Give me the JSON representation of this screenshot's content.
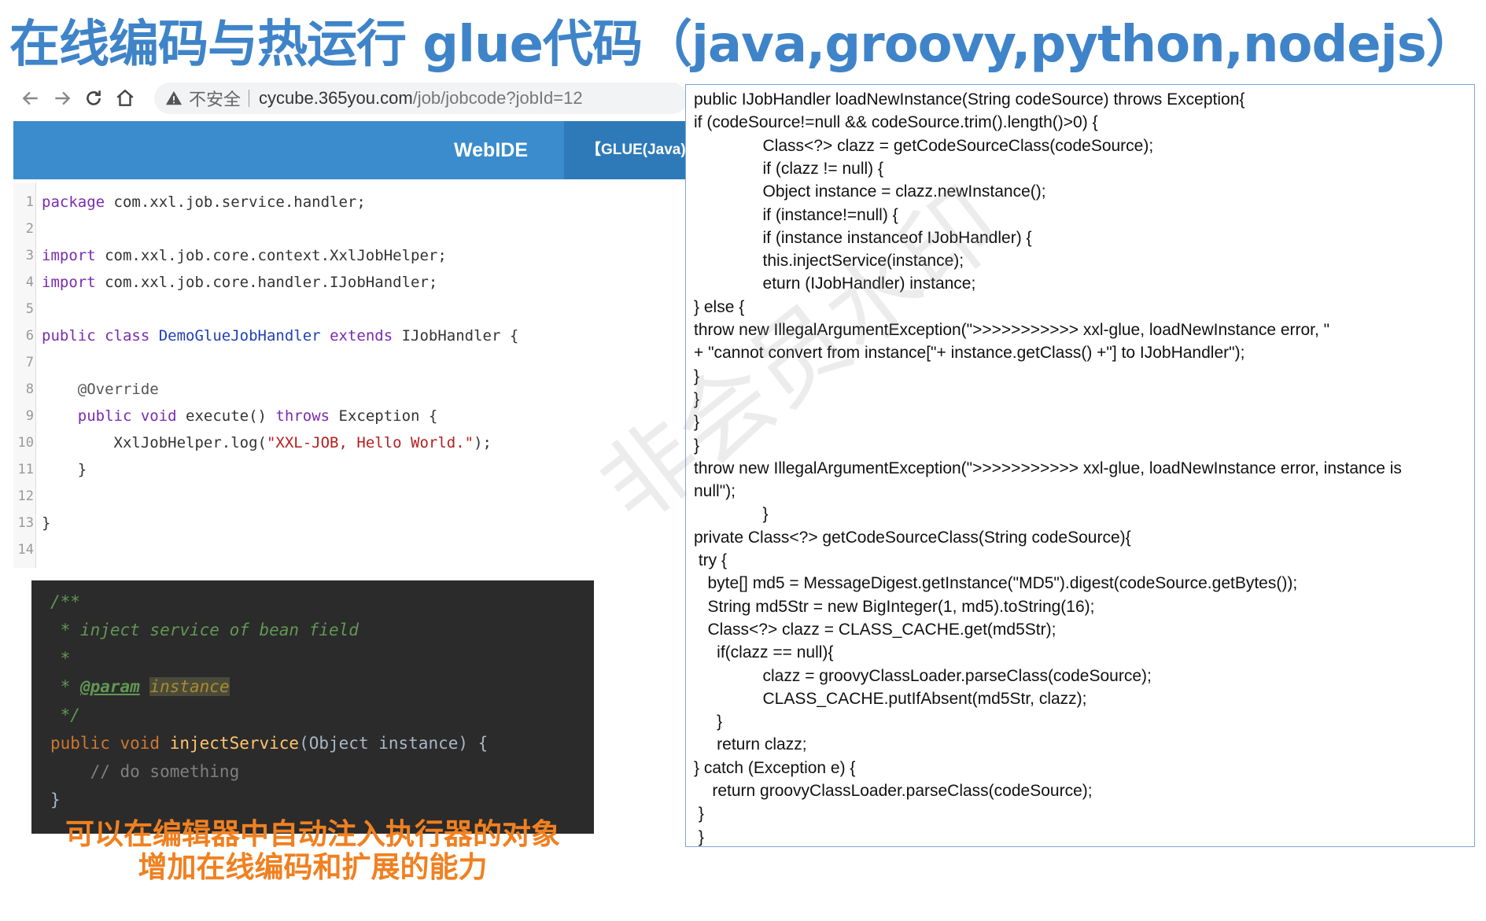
{
  "title": "在线编码与热运行 glue代码（java,groovy,python,nodejs）",
  "browser": {
    "insecure_label": "不安全",
    "url_host": "cycube.365you.com",
    "url_path": "/job/jobcode?jobId=12",
    "icons": [
      "back-icon",
      "forward-icon",
      "reload-icon",
      "home-icon",
      "warning-icon"
    ]
  },
  "ide": {
    "brand": "WebIDE",
    "tab": "【GLUE(Java)】"
  },
  "editor_lines": [
    {
      "n": "1",
      "parts": [
        [
          "kw",
          "package"
        ],
        [
          "t",
          " com.xxl.job.service.handler;"
        ]
      ]
    },
    {
      "n": "2",
      "parts": []
    },
    {
      "n": "3",
      "parts": [
        [
          "kw",
          "import"
        ],
        [
          "t",
          " com.xxl.job.core.context.XxlJobHelper;"
        ]
      ]
    },
    {
      "n": "4",
      "parts": [
        [
          "kw",
          "import"
        ],
        [
          "t",
          " com.xxl.job.core.handler.IJobHandler;"
        ]
      ]
    },
    {
      "n": "5",
      "parts": []
    },
    {
      "n": "6",
      "parts": [
        [
          "kw",
          "public class "
        ],
        [
          "cls",
          "DemoGlueJobHandler"
        ],
        [
          "kw",
          " extends"
        ],
        [
          "t",
          " IJobHandler {"
        ]
      ]
    },
    {
      "n": "7",
      "parts": []
    },
    {
      "n": "8",
      "parts": [
        [
          "ann",
          "    @Override"
        ]
      ]
    },
    {
      "n": "9",
      "parts": [
        [
          "kw",
          "    public void"
        ],
        [
          "t",
          " execute() "
        ],
        [
          "kw",
          "throws"
        ],
        [
          "t",
          " Exception {"
        ]
      ]
    },
    {
      "n": "10",
      "parts": [
        [
          "t",
          "        XxlJobHelper.log("
        ],
        [
          "str",
          "\"XXL-JOB, Hello World.\""
        ],
        [
          "t",
          ");"
        ]
      ]
    },
    {
      "n": "11",
      "parts": [
        [
          "t",
          "    }"
        ]
      ]
    },
    {
      "n": "12",
      "parts": []
    },
    {
      "n": "13",
      "parts": [
        [
          "t",
          "}"
        ]
      ]
    },
    {
      "n": "14",
      "parts": []
    }
  ],
  "dark_lines": [
    [
      [
        "doc",
        "/**"
      ]
    ],
    [
      [
        "doc",
        " * inject service of bean field"
      ]
    ],
    [
      [
        "doc",
        " *"
      ]
    ],
    [
      [
        "doc",
        " * "
      ],
      [
        "dparam",
        "@param"
      ],
      [
        "doc",
        " "
      ],
      [
        "dinst",
        "instance"
      ]
    ],
    [
      [
        "doc",
        " */"
      ]
    ],
    [
      [
        "dkw",
        "public void "
      ],
      [
        "dfn",
        "injectService"
      ],
      [
        "dtx",
        "(Object instance) {"
      ]
    ],
    [
      [
        "dcm",
        "    // do something"
      ]
    ],
    [
      [
        "dtx",
        "}"
      ]
    ]
  ],
  "caption_line1": "可以在编辑器中自动注入执行器的对象",
  "caption_line2": "增加在线编码和扩展的能力",
  "right_code": [
    "public IJobHandler loadNewInstance(String codeSource) throws Exception{",
    "if (codeSource!=null && codeSource.trim().length()>0) {",
    "               Class<?> clazz = getCodeSourceClass(codeSource);",
    "               if (clazz != null) {",
    "               Object instance = clazz.newInstance();",
    "               if (instance!=null) {",
    "               if (instance instanceof IJobHandler) {",
    "               this.injectService(instance);",
    "               eturn (IJobHandler) instance;",
    "} else {",
    "throw new IllegalArgumentException(\">>>>>>>>>>> xxl-glue, loadNewInstance error, \"",
    "+ \"cannot convert from instance[\"+ instance.getClass() +\"] to IJobHandler\");",
    "}",
    "}",
    "}",
    "}",
    "throw new IllegalArgumentException(\">>>>>>>>>>> xxl-glue, loadNewInstance error, instance is",
    "null\");",
    "               }",
    "private Class<?> getCodeSourceClass(String codeSource){",
    " try {",
    "   byte[] md5 = MessageDigest.getInstance(\"MD5\").digest(codeSource.getBytes());",
    "   String md5Str = new BigInteger(1, md5).toString(16);",
    "   Class<?> clazz = CLASS_CACHE.get(md5Str);",
    "     if(clazz == null){",
    "               clazz = groovyClassLoader.parseClass(codeSource);",
    "               CLASS_CACHE.putIfAbsent(md5Str, clazz);",
    "     }",
    "     return clazz;",
    "} catch (Exception e) {",
    "    return groovyClassLoader.parseClass(codeSource);",
    " }",
    " }"
  ],
  "watermark": "非会员水印"
}
